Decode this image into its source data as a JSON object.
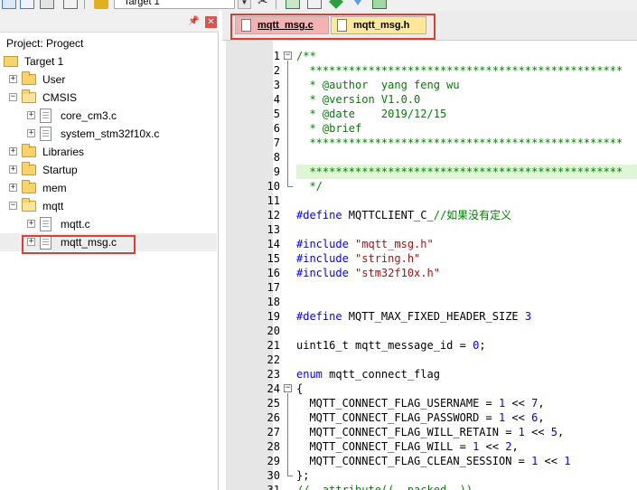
{
  "toolbar": {
    "target": "Target 1",
    "dropdown_icon": "chevron-down-icon",
    "icons": [
      "grid-icon",
      "window-icon",
      "stack-icon",
      "copy-icon",
      "build-icon",
      "wand-icon",
      "target-options-icon",
      "layers-icon",
      "diamond-down-icon",
      "funnel-icon",
      "check-icon"
    ]
  },
  "project_panel": {
    "title": "Project: Progect",
    "pin_icon": "pin-icon",
    "close_icon": "close-icon",
    "tree": [
      {
        "label": "Target 1",
        "type": "target",
        "depth": 0,
        "expander": ""
      },
      {
        "label": "User",
        "type": "folder",
        "depth": 1,
        "expander": "+"
      },
      {
        "label": "CMSIS",
        "type": "folder-open",
        "depth": 1,
        "expander": "−"
      },
      {
        "label": "core_cm3.c",
        "type": "file",
        "depth": 2,
        "expander": "+"
      },
      {
        "label": "system_stm32f10x.c",
        "type": "file",
        "depth": 2,
        "expander": "+"
      },
      {
        "label": "Libraries",
        "type": "folder",
        "depth": 1,
        "expander": "+"
      },
      {
        "label": "Startup",
        "type": "folder",
        "depth": 1,
        "expander": "+"
      },
      {
        "label": "mem",
        "type": "folder",
        "depth": 1,
        "expander": "+"
      },
      {
        "label": "mqtt",
        "type": "folder-open",
        "depth": 1,
        "expander": "−"
      },
      {
        "label": "mqtt.c",
        "type": "file",
        "depth": 2,
        "expander": "+"
      },
      {
        "label": "mqtt_msg.c",
        "type": "file",
        "depth": 2,
        "expander": "+",
        "selected": true
      }
    ]
  },
  "editor": {
    "tabs": [
      {
        "label": "mqtt_msg.c",
        "active": true
      },
      {
        "label": "mqtt_msg.h",
        "active": false
      }
    ],
    "lines": [
      {
        "n": "1",
        "fold": "−",
        "segs": [
          [
            "c-comment",
            "/**"
          ]
        ]
      },
      {
        "n": "2",
        "segs": [
          [
            "c-comment",
            "  ************************************************"
          ]
        ]
      },
      {
        "n": "3",
        "segs": [
          [
            "c-comment",
            "  * @author  yang feng wu"
          ]
        ]
      },
      {
        "n": "4",
        "segs": [
          [
            "c-comment",
            "  * @version V1.0.0"
          ]
        ]
      },
      {
        "n": "5",
        "segs": [
          [
            "c-comment",
            "  * @date    2019/12/15"
          ]
        ]
      },
      {
        "n": "6",
        "segs": [
          [
            "c-comment",
            "  * @brief"
          ]
        ]
      },
      {
        "n": "7",
        "segs": [
          [
            "c-comment",
            "  ************************************************"
          ]
        ]
      },
      {
        "n": "8",
        "segs": [
          [
            "c-comment",
            ""
          ]
        ]
      },
      {
        "n": "9",
        "current": true,
        "segs": [
          [
            "c-comment",
            "  ************************************************"
          ]
        ]
      },
      {
        "n": "10",
        "segs": [
          [
            "c-comment",
            "  */"
          ]
        ]
      },
      {
        "n": "11",
        "segs": []
      },
      {
        "n": "12",
        "segs": [
          [
            "c-pp",
            "#define"
          ],
          [
            "c-text",
            " MQTTCLIENT_C_"
          ],
          [
            "c-comment",
            "//如果没有定义"
          ]
        ]
      },
      {
        "n": "13",
        "segs": []
      },
      {
        "n": "14",
        "segs": [
          [
            "c-pp",
            "#include"
          ],
          [
            "c-text",
            " "
          ],
          [
            "c-str",
            "\"mqtt_msg.h\""
          ]
        ]
      },
      {
        "n": "15",
        "segs": [
          [
            "c-pp",
            "#include"
          ],
          [
            "c-text",
            " "
          ],
          [
            "c-str",
            "\"string.h\""
          ]
        ]
      },
      {
        "n": "16",
        "segs": [
          [
            "c-pp",
            "#include"
          ],
          [
            "c-text",
            " "
          ],
          [
            "c-str",
            "\"stm32f10x.h\""
          ]
        ]
      },
      {
        "n": "17",
        "segs": []
      },
      {
        "n": "18",
        "segs": []
      },
      {
        "n": "19",
        "segs": [
          [
            "c-pp",
            "#define"
          ],
          [
            "c-text",
            " MQTT_MAX_FIXED_HEADER_SIZE "
          ],
          [
            "c-num",
            "3"
          ]
        ]
      },
      {
        "n": "20",
        "segs": []
      },
      {
        "n": "21",
        "segs": [
          [
            "c-text",
            "uint16_t mqtt_message_id = "
          ],
          [
            "c-num",
            "0"
          ],
          [
            "c-text",
            ";"
          ]
        ]
      },
      {
        "n": "22",
        "segs": []
      },
      {
        "n": "23",
        "segs": [
          [
            "c-kw",
            "enum"
          ],
          [
            "c-text",
            " mqtt_connect_flag"
          ]
        ]
      },
      {
        "n": "24",
        "fold": "−",
        "segs": [
          [
            "c-text",
            "{"
          ]
        ]
      },
      {
        "n": "25",
        "segs": [
          [
            "c-text",
            "  MQTT_CONNECT_FLAG_USERNAME = "
          ],
          [
            "c-num",
            "1"
          ],
          [
            "c-text",
            " << "
          ],
          [
            "c-num",
            "7"
          ],
          [
            "c-text",
            ","
          ]
        ]
      },
      {
        "n": "26",
        "segs": [
          [
            "c-text",
            "  MQTT_CONNECT_FLAG_PASSWORD = "
          ],
          [
            "c-num",
            "1"
          ],
          [
            "c-text",
            " << "
          ],
          [
            "c-num",
            "6"
          ],
          [
            "c-text",
            ","
          ]
        ]
      },
      {
        "n": "27",
        "segs": [
          [
            "c-text",
            "  MQTT_CONNECT_FLAG_WILL_RETAIN = "
          ],
          [
            "c-num",
            "1"
          ],
          [
            "c-text",
            " << "
          ],
          [
            "c-num",
            "5"
          ],
          [
            "c-text",
            ","
          ]
        ]
      },
      {
        "n": "28",
        "segs": [
          [
            "c-text",
            "  MQTT_CONNECT_FLAG_WILL = "
          ],
          [
            "c-num",
            "1"
          ],
          [
            "c-text",
            " << "
          ],
          [
            "c-num",
            "2"
          ],
          [
            "c-text",
            ","
          ]
        ]
      },
      {
        "n": "29",
        "segs": [
          [
            "c-text",
            "  MQTT_CONNECT_FLAG_CLEAN_SESSION = "
          ],
          [
            "c-num",
            "1"
          ],
          [
            "c-text",
            " << "
          ],
          [
            "c-num",
            "1"
          ]
        ]
      },
      {
        "n": "30",
        "segs": [
          [
            "c-text",
            "};"
          ]
        ]
      },
      {
        "n": "31",
        "segs": [
          [
            "c-comment",
            "//__attribute((__packed__))"
          ]
        ]
      }
    ]
  },
  "colors": {
    "highlight_box": "#e03c31",
    "active_tab": "#f4b2b2",
    "inactive_tab": "#fde79a",
    "comment": "#008000",
    "keyword": "#0000ff",
    "string": "#a31515",
    "current_line": "#dff5d6"
  }
}
